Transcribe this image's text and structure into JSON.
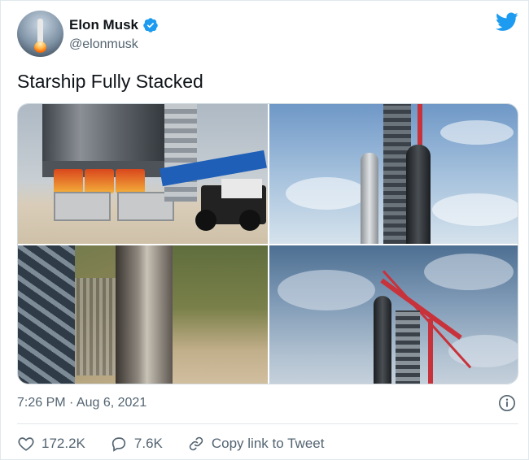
{
  "author": {
    "display_name": "Elon Musk",
    "handle": "@elonmusk",
    "verified": true
  },
  "tweet": {
    "text": "Starship Fully Stacked",
    "timestamp": "7:26 PM · Aug 6, 2021"
  },
  "actions": {
    "likes": "172.2K",
    "replies": "7.6K",
    "copy_link_label": "Copy link to Tweet"
  },
  "colors": {
    "twitter_blue": "#1d9bf0",
    "text_secondary": "#536471"
  },
  "icons": [
    "twitter-bird-icon",
    "verified-badge-icon",
    "info-icon",
    "heart-icon",
    "reply-icon",
    "link-icon"
  ]
}
